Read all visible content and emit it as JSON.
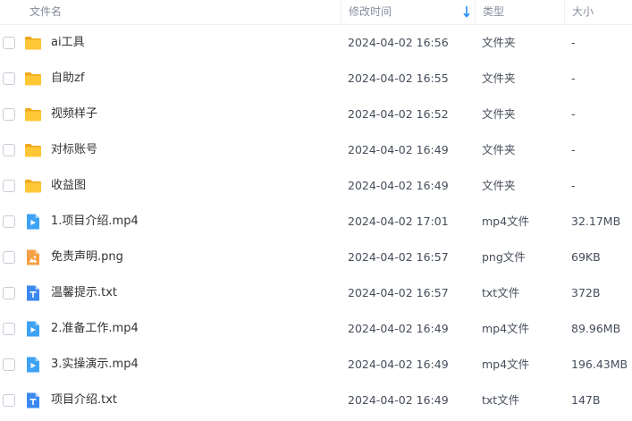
{
  "header": {
    "name": "文件名",
    "time": "修改时间",
    "type": "类型",
    "size": "大小",
    "sort_icon": "arrow-down-icon",
    "sort_color": "#1e8cff"
  },
  "icon_colors": {
    "folder": "#ffc736",
    "video": "#3ea2f5",
    "image": "#f5a044",
    "text": "#3b88f0"
  },
  "files": [
    {
      "icon": "folder-icon",
      "name": "ai工具",
      "time": "2024-04-02 16:56",
      "type": "文件夹",
      "size": "-"
    },
    {
      "icon": "folder-icon",
      "name": "自助zf",
      "time": "2024-04-02 16:55",
      "type": "文件夹",
      "size": "-"
    },
    {
      "icon": "folder-icon",
      "name": "视频样子",
      "time": "2024-04-02 16:52",
      "type": "文件夹",
      "size": "-"
    },
    {
      "icon": "folder-icon",
      "name": "对标账号",
      "time": "2024-04-02 16:49",
      "type": "文件夹",
      "size": "-"
    },
    {
      "icon": "folder-icon",
      "name": "收益图",
      "time": "2024-04-02 16:49",
      "type": "文件夹",
      "size": "-"
    },
    {
      "icon": "video-file-icon",
      "name": "1.项目介绍.mp4",
      "time": "2024-04-02 17:01",
      "type": "mp4文件",
      "size": "32.17MB"
    },
    {
      "icon": "image-file-icon",
      "name": "免责声明.png",
      "time": "2024-04-02 16:57",
      "type": "png文件",
      "size": "69KB"
    },
    {
      "icon": "text-file-icon",
      "name": "温馨提示.txt",
      "time": "2024-04-02 16:57",
      "type": "txt文件",
      "size": "372B"
    },
    {
      "icon": "video-file-icon",
      "name": "2.准备工作.mp4",
      "time": "2024-04-02 16:49",
      "type": "mp4文件",
      "size": "89.96MB"
    },
    {
      "icon": "video-file-icon",
      "name": "3.实操演示.mp4",
      "time": "2024-04-02 16:49",
      "type": "mp4文件",
      "size": "196.43MB"
    },
    {
      "icon": "text-file-icon",
      "name": "项目介绍.txt",
      "time": "2024-04-02 16:49",
      "type": "txt文件",
      "size": "147B"
    }
  ]
}
